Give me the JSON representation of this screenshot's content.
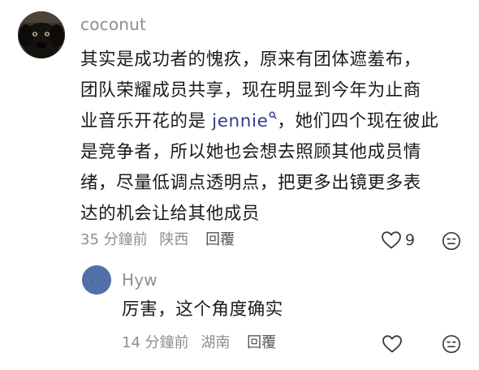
{
  "comments": [
    {
      "username": "coconut",
      "lines": [
        "其实是成功者的愧疚，原来有团体遮羞布，",
        "团队荣耀成员共享，现在明显到今年为止商",
        "业音乐开花的是 ",
        "是竞争者，所以她也会想去照顾其他成员情",
        "绪，尽量低调点透明点，把更多出镜更多表",
        "达的机会让给其他成员"
      ],
      "mention": "jennie",
      "line3_after": "，她们四个现在彼此",
      "time": "35 分鐘前",
      "location": "陕西",
      "reply_label": "回覆",
      "like_count": "9",
      "mention_icon": "search-icon",
      "avatar_icon": "dog-avatar",
      "like_icon": "heart-outline-icon",
      "dislike_icon": "meh-face-icon"
    },
    {
      "username": "Hyw",
      "text": "厉害，这个角度确实",
      "time": "14 分鐘前",
      "location": "湖南",
      "reply_label": "回覆",
      "like_count": "",
      "avatar_color": "#5170a7",
      "like_icon": "heart-outline-icon",
      "dislike_icon": "meh-face-icon"
    }
  ]
}
